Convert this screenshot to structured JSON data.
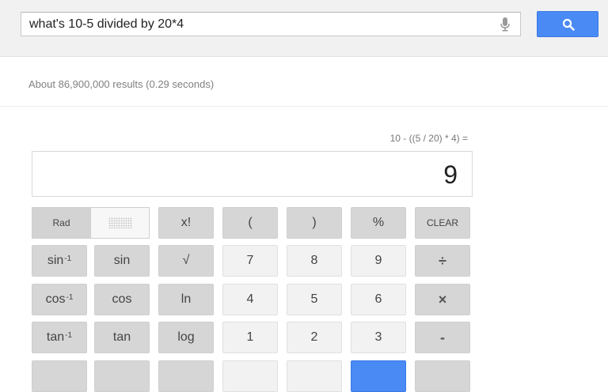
{
  "search": {
    "query": "what's 10-5 divided by 20*4"
  },
  "results": {
    "stats": "About 86,900,000 results (0.29 seconds)"
  },
  "calculator": {
    "equation": "10 - ((5 / 20) * 4) =",
    "display": "9",
    "rad_label": "Rad",
    "keys": {
      "factorial": "x!",
      "open_paren": "(",
      "close_paren": ")",
      "percent": "%",
      "clear": "CLEAR",
      "arcsin": "sin",
      "sin": "sin",
      "sqrt": "√",
      "seven": "7",
      "eight": "8",
      "nine": "9",
      "divide": "÷",
      "arccos": "cos",
      "cos": "cos",
      "ln": "ln",
      "four": "4",
      "five": "5",
      "six": "6",
      "multiply": "×",
      "arctan": "tan",
      "tan": "tan",
      "log": "log",
      "one": "1",
      "two": "2",
      "three": "3",
      "minus": "-",
      "inverse_sup": "-1"
    }
  },
  "colors": {
    "accent": "#4a8af4",
    "key_dark": "#d6d6d6",
    "key_light": "#f2f2f2"
  }
}
